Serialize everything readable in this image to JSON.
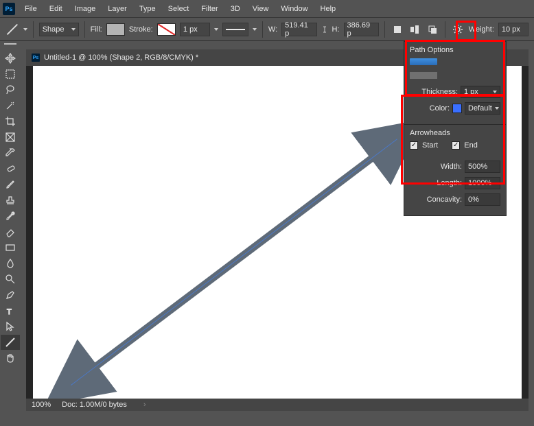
{
  "menu": [
    "File",
    "Edit",
    "Image",
    "Layer",
    "Type",
    "Select",
    "Filter",
    "3D",
    "View",
    "Window",
    "Help"
  ],
  "optbar": {
    "mode": "Shape",
    "fill_label": "Fill:",
    "stroke_label": "Stroke:",
    "stroke_width": "1 px",
    "w_label": "W:",
    "w_value": "519.41 p",
    "h_label": "H:",
    "h_value": "386.69 p",
    "weight_label": "Weight:",
    "weight_value": "10 px"
  },
  "document": {
    "title": "Untitled-1 @ 100% (Shape 2, RGB/8/CMYK) *",
    "zoom": "100%",
    "doc_info": "Doc: 1.00M/0 bytes"
  },
  "tools": [
    "move",
    "marquee",
    "lasso",
    "wand",
    "crop",
    "frame",
    "eyedropper",
    "heal",
    "brush",
    "stamp",
    "history-brush",
    "eraser",
    "gradient",
    "blur",
    "dodge",
    "pen",
    "type",
    "path-select",
    "line",
    "hand"
  ],
  "panel": {
    "path_options_title": "Path Options",
    "thickness_label": "Thickness:",
    "thickness_value": "1 px",
    "color_label": "Color:",
    "color_value": "Default",
    "arrowheads_title": "Arrowheads",
    "start_label": "Start",
    "start_checked": true,
    "end_label": "End",
    "end_checked": true,
    "width_label": "Width:",
    "width_value": "500%",
    "length_label": "Length:",
    "length_value": "1000%",
    "concavity_label": "Concavity:",
    "concavity_value": "0%"
  }
}
